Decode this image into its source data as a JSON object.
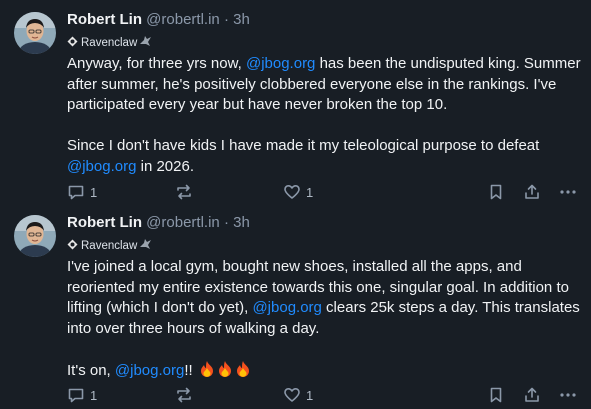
{
  "posts": [
    {
      "author": "Robert Lin",
      "handle": "@robertl.in",
      "separator": "·",
      "time": "3h",
      "badge": "Ravenclaw",
      "paragraphs": [
        [
          {
            "t": "Anyway, for three yrs now, "
          },
          {
            "t": "@jbog.org",
            "m": true
          },
          {
            "t": " has been the undisputed king. Summer after summer, he's positively clobbered everyone else in the rankings. I've participated every year but have never broken the top 10."
          }
        ],
        [
          {
            "t": "Since I don't have kids I have made it my teleological purpose to defeat "
          },
          {
            "t": "@jbog.org",
            "m": true
          },
          {
            "t": " in 2026."
          }
        ]
      ],
      "reply_count": "1",
      "repost_count": "",
      "like_count": "1"
    },
    {
      "author": "Robert Lin",
      "handle": "@robertl.in",
      "separator": "·",
      "time": "3h",
      "badge": "Ravenclaw",
      "paragraphs": [
        [
          {
            "t": "I've joined a local gym, bought new shoes, installed all the apps, and reoriented my entire existence towards this one, singular goal. In addition to lifting (which I don't do yet), "
          },
          {
            "t": "@jbog.org",
            "m": true
          },
          {
            "t": " clears 25k steps a day. This translates into over three hours of walking a day."
          }
        ],
        [
          {
            "t": "It's on, "
          },
          {
            "t": "@jbog.org",
            "m": true
          },
          {
            "t": "!! "
          }
        ]
      ],
      "fire_emoji_count": 3,
      "reply_count": "1",
      "repost_count": "",
      "like_count": "1"
    }
  ],
  "icons": [
    "avatar",
    "ravenclaw-symbol-icon",
    "ravenclaw-crest-icon",
    "reply-icon",
    "repost-icon",
    "like-icon",
    "bookmark-icon",
    "share-icon",
    "more-icon",
    "fire-emoji"
  ],
  "colors": {
    "background": "#181e25",
    "text": "#f1f3f5",
    "muted": "#8b98a9",
    "mention": "#208bfe"
  }
}
